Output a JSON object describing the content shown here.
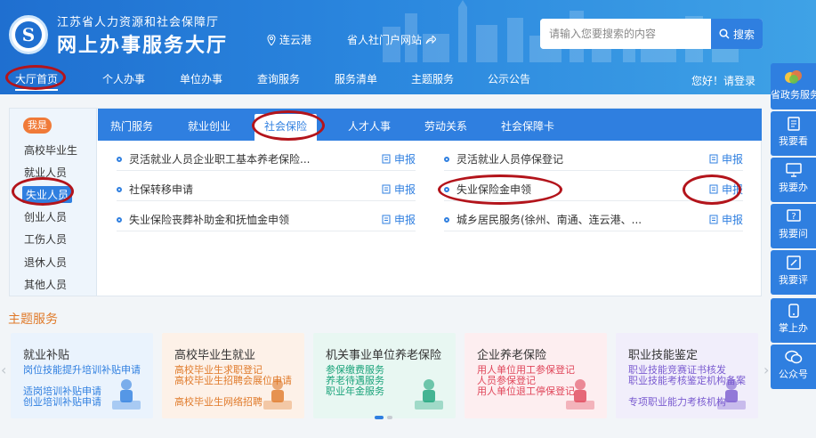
{
  "header": {
    "org_name": "江苏省人力资源和社会保障厅",
    "site_name": "网上办事服务大厅",
    "location": "连云港",
    "portal_link": "省人社门户网站",
    "search": {
      "placeholder": "请输入您要搜索的内容",
      "button": "搜索"
    }
  },
  "nav": {
    "items": [
      "大厅首页",
      "个人办事",
      "单位办事",
      "查询服务",
      "服务清单",
      "主题服务",
      "公示公告"
    ],
    "active": "大厅首页",
    "login": "您好！请登录"
  },
  "sidebar": {
    "badge": "我是",
    "items": [
      "高校毕业生",
      "就业人员",
      "失业人员",
      "创业人员",
      "工伤人员",
      "退休人员",
      "其他人员"
    ],
    "active": "失业人员"
  },
  "tabs": {
    "items": [
      "热门服务",
      "就业创业",
      "社会保险",
      "人才人事",
      "劳动关系",
      "社会保障卡"
    ],
    "active": "社会保险"
  },
  "services": {
    "apply_label": "申报",
    "left": [
      "灵活就业人员企业职工基本养老保险...",
      "社保转移申请",
      "失业保险丧葬补助金和抚恤金申领"
    ],
    "right": [
      "灵活就业人员停保登记",
      "失业保险金申领",
      "城乡居民服务(徐州、南通、连云港、..."
    ]
  },
  "theme": {
    "title": "主题服务",
    "cards": [
      {
        "title": "就业补贴",
        "items": [
          "岗位技能提升培训补贴申请",
          "适岗培训补贴申请",
          "创业培训补贴申请"
        ],
        "bg": "#eaf3fd",
        "color": "#2f7fe0"
      },
      {
        "title": "高校毕业生就业",
        "items": [
          "高校毕业生求职登记",
          "高校毕业生招聘会展位申请",
          "高校毕业生网络招聘"
        ],
        "bg": "#fdf1e8",
        "color": "#e07a2a"
      },
      {
        "title": "机关事业单位养老保险",
        "items": [
          "参保缴费服务",
          "养老待遇服务",
          "职业年金服务"
        ],
        "bg": "#e8f7f2",
        "color": "#1aa37a"
      },
      {
        "title": "企业养老保险",
        "items": [
          "用人单位用工参保登记",
          "人员参保登记",
          "用人单位退工停保登记"
        ],
        "bg": "#fdeef0",
        "color": "#e0465a"
      },
      {
        "title": "职业技能鉴定",
        "items": [
          "职业技能竞赛证书核发",
          "职业技能考核鉴定机构备案",
          "专项职业能力考核机构"
        ],
        "bg": "#f1eefb",
        "color": "#7a5bd0"
      }
    ]
  },
  "right_bar": [
    "省政务服务",
    "我要看",
    "我要办",
    "我要问",
    "我要评",
    "掌上办",
    "公众号"
  ]
}
